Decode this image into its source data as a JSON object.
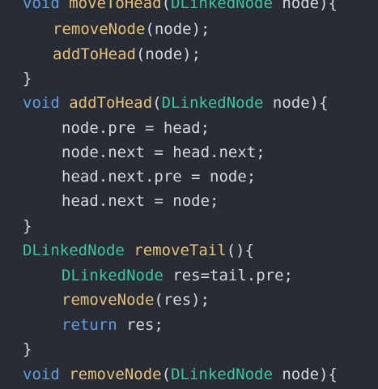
{
  "code": {
    "lines": [
      {
        "segments": [
          {
            "text": "void",
            "cls": "kw"
          },
          {
            "text": " ",
            "cls": "plain"
          },
          {
            "text": "moveToHead",
            "cls": "fn"
          },
          {
            "text": "(",
            "cls": "plain"
          },
          {
            "text": "DLinkedNode",
            "cls": "type"
          },
          {
            "text": " node){",
            "cls": "plain"
          }
        ]
      },
      {
        "segments": [
          {
            "text": "removeNode",
            "cls": "fn"
          },
          {
            "text": "(node);",
            "cls": "plain"
          }
        ]
      },
      {
        "segments": [
          {
            "text": "addToHead",
            "cls": "fn"
          },
          {
            "text": "(node);",
            "cls": "plain"
          }
        ]
      },
      {
        "segments": [
          {
            "text": "}",
            "cls": "plain"
          }
        ]
      },
      {
        "segments": [
          {
            "text": "void",
            "cls": "kw"
          },
          {
            "text": " ",
            "cls": "plain"
          },
          {
            "text": "addToHead",
            "cls": "fn"
          },
          {
            "text": "(",
            "cls": "plain"
          },
          {
            "text": "DLinkedNode",
            "cls": "type"
          },
          {
            "text": " node){",
            "cls": "plain"
          }
        ]
      },
      {
        "segments": [
          {
            "text": "node.pre = head;",
            "cls": "plain"
          }
        ]
      },
      {
        "segments": [
          {
            "text": "node.next = head.next;",
            "cls": "plain"
          }
        ]
      },
      {
        "segments": [
          {
            "text": "head.next.pre = node;",
            "cls": "plain"
          }
        ]
      },
      {
        "segments": [
          {
            "text": "head.next = node;",
            "cls": "plain"
          }
        ]
      },
      {
        "segments": [
          {
            "text": "}",
            "cls": "plain"
          }
        ]
      },
      {
        "segments": [
          {
            "text": "DLinkedNode",
            "cls": "type"
          },
          {
            "text": " ",
            "cls": "plain"
          },
          {
            "text": "removeTail",
            "cls": "fn"
          },
          {
            "text": "(){",
            "cls": "plain"
          }
        ]
      },
      {
        "segments": [
          {
            "text": "DLinkedNode",
            "cls": "type"
          },
          {
            "text": " res=tail.pre;",
            "cls": "plain"
          }
        ]
      },
      {
        "segments": [
          {
            "text": "removeNode",
            "cls": "fn"
          },
          {
            "text": "(res);",
            "cls": "plain"
          }
        ]
      },
      {
        "segments": [
          {
            "text": "return",
            "cls": "kw"
          },
          {
            "text": " res;",
            "cls": "plain"
          }
        ]
      },
      {
        "segments": [
          {
            "text": "}",
            "cls": "plain"
          }
        ]
      },
      {
        "segments": [
          {
            "text": "void",
            "cls": "kw"
          },
          {
            "text": " ",
            "cls": "plain"
          },
          {
            "text": "removeNode",
            "cls": "fn"
          },
          {
            "text": "(",
            "cls": "plain"
          },
          {
            "text": "DLinkedNode",
            "cls": "type"
          },
          {
            "text": " node){",
            "cls": "plain"
          }
        ]
      }
    ]
  }
}
